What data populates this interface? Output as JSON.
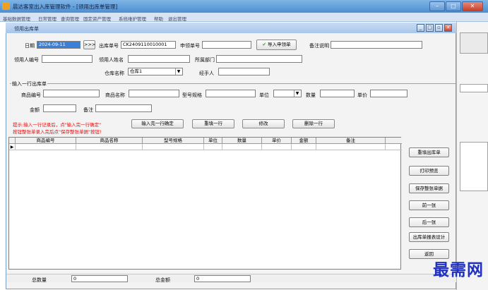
{
  "app": {
    "title": "晨达客室出入库管理软件",
    "window_title": "- [领用出库单管理]"
  },
  "menu": [
    "基础数据管理",
    "日常管理",
    "查询管理",
    "固定资产管理",
    "系统维护管理",
    "帮助",
    "退出管理"
  ],
  "child": {
    "title": "领用出库单"
  },
  "header": {
    "date_label": "日期",
    "date_value": "2024-09-11",
    "date_btn": ">>>",
    "outno_label": "出库单号",
    "outno_value": "CK2409110010001",
    "applyno_label": "申领单号",
    "applyno_value": "",
    "import_btn": "导入申领单",
    "remark_label": "备注说明",
    "remark_value": "",
    "user_no_label": "领用人编号",
    "user_no_value": "",
    "user_name_label": "领用人姓名",
    "user_name_value": "",
    "dept_label": "所属部门",
    "dept_value": "",
    "wh_label": "仓库名称",
    "wh_value": "仓库1",
    "handler_label": "经手人",
    "handler_value": ""
  },
  "line_group": {
    "title": "输入一行出库单",
    "code_label": "商品编号",
    "name_label": "商品名称",
    "model_label": "型号规格",
    "unit_label": "单位",
    "qty_label": "数量",
    "price_label": "单价",
    "amount_label": "金额",
    "note_label": "备注"
  },
  "tip": {
    "line1": "提示:输入一行记录后，点\"输入完一行确定\"",
    "line2": "按钮整张单录入完后点\"保存整张单据\"按钮!"
  },
  "line_buttons": {
    "confirm": "输入完一行确定",
    "refill": "重填一行",
    "modify": "修改",
    "delete": "删除一行"
  },
  "grid": {
    "columns": [
      "商品编号",
      "商品名称",
      "型号规格",
      "单位",
      "数量",
      "单价",
      "金额",
      "备注"
    ],
    "row_marker": "▶"
  },
  "side_buttons": {
    "refill_doc": "重填出库单",
    "print_preview": "打印预览",
    "save_doc": "保存整张单据",
    "prev": "前一张",
    "next": "后一张",
    "design": "出库单报表设计",
    "back": "返回"
  },
  "status": {
    "total_qty_label": "总数量",
    "total_qty": "0",
    "total_amt_label": "总金额",
    "total_amt": "0"
  },
  "watermark": "最需网"
}
